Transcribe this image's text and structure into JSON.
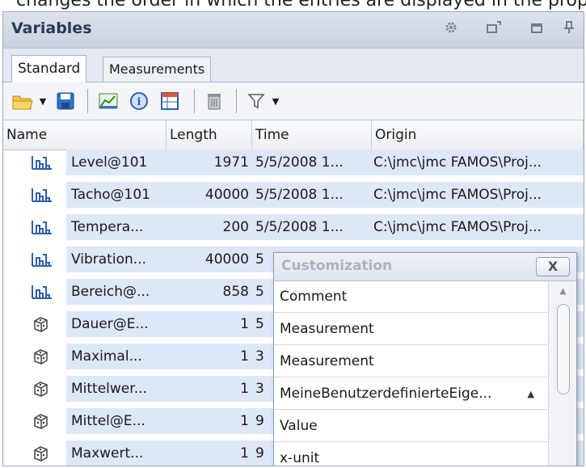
{
  "top_text": "changes the order in which the entries are displayed in the property window",
  "panel": {
    "title": "Variables",
    "icons": [
      "gear-icon",
      "float-window-icon",
      "maximize-icon",
      "pin-icon"
    ]
  },
  "tabs": [
    {
      "label": "Standard",
      "active": true
    },
    {
      "label": "Measurements",
      "active": false
    }
  ],
  "toolbar": {
    "buttons": [
      "open-folder-icon",
      "dropdown-arrow-icon",
      "save-icon",
      "chart-icon",
      "info-icon",
      "table-icon",
      "delete-icon",
      "filter-icon",
      "filter-dropdown-icon"
    ]
  },
  "grid": {
    "columns": [
      "Name",
      "Length",
      "Time",
      "Origin"
    ],
    "rows": [
      {
        "icon": "waveform-icon",
        "name": "Level@101",
        "length": "1971",
        "time": "5/5/2008 1...",
        "origin": "C:\\jmc\\jmc FAMOS\\Proj..."
      },
      {
        "icon": "waveform-icon",
        "name": "Tacho@101",
        "length": "40000",
        "time": "5/5/2008 1...",
        "origin": "C:\\jmc\\jmc FAMOS\\Proj..."
      },
      {
        "icon": "waveform-icon",
        "name": "Tempera...",
        "length": "200",
        "time": "5/5/2008 1...",
        "origin": "C:\\jmc\\jmc FAMOS\\Proj..."
      },
      {
        "icon": "waveform-icon",
        "name": "Vibration...",
        "length": "40000",
        "time": "5",
        "origin": ""
      },
      {
        "icon": "waveform-icon",
        "name": "Bereich@...",
        "length": "858",
        "time": "5",
        "origin": ""
      },
      {
        "icon": "cube-icon",
        "name": "Dauer@E...",
        "length": "1",
        "time": "5",
        "origin": ""
      },
      {
        "icon": "cube-icon",
        "name": "Maximal...",
        "length": "1",
        "time": "3",
        "origin": ""
      },
      {
        "icon": "cube-icon",
        "name": "Mittelwer...",
        "length": "1",
        "time": "3",
        "origin": ""
      },
      {
        "icon": "cube-icon",
        "name": "Mittel@E...",
        "length": "1",
        "time": "9",
        "origin": ""
      },
      {
        "icon": "cube-icon",
        "name": "Maxwert...",
        "length": "1",
        "time": "9",
        "origin": ""
      }
    ]
  },
  "customization": {
    "title": "Customization",
    "close_label": "X",
    "items": [
      {
        "label": "Comment"
      },
      {
        "label": "Measurement"
      },
      {
        "label": "Measurement"
      },
      {
        "label": "MeineBenutzerdefinierteEige...",
        "arrow": "▲"
      },
      {
        "label": "Value"
      },
      {
        "label": "x-unit"
      }
    ],
    "scroll_up": "▲",
    "scroll_down": "▼"
  },
  "colors": {
    "row_highlight": "#dde7f8",
    "title_text": "#2b3a55"
  }
}
